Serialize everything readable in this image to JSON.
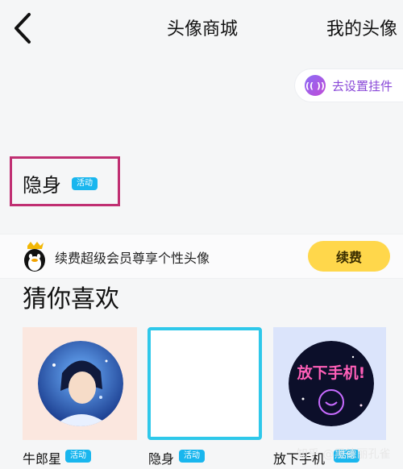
{
  "nav": {
    "title": "头像商城",
    "mine_tab": "我的头像"
  },
  "pendant": {
    "icon_text": "(( ))",
    "label": "去设置挂件"
  },
  "current": {
    "name": "隐身",
    "badge": "活动"
  },
  "vip": {
    "text": "续费超级会员尊享个性头像",
    "button": "续费"
  },
  "guess": {
    "title": "猜你喜欢",
    "items": [
      {
        "name": "牛郎星",
        "badge": "活动"
      },
      {
        "name": "隐身",
        "badge": "活动"
      },
      {
        "name": "放下手机",
        "badge": "活动",
        "art_text": "放下手机!"
      }
    ]
  },
  "watermark": "知乎 @黑德丽孔雀",
  "colors": {
    "badge": "#19b6ee",
    "renew": "#ffd74b",
    "selected_border": "#2ec8ea",
    "highlight_box": "#c02f72"
  }
}
